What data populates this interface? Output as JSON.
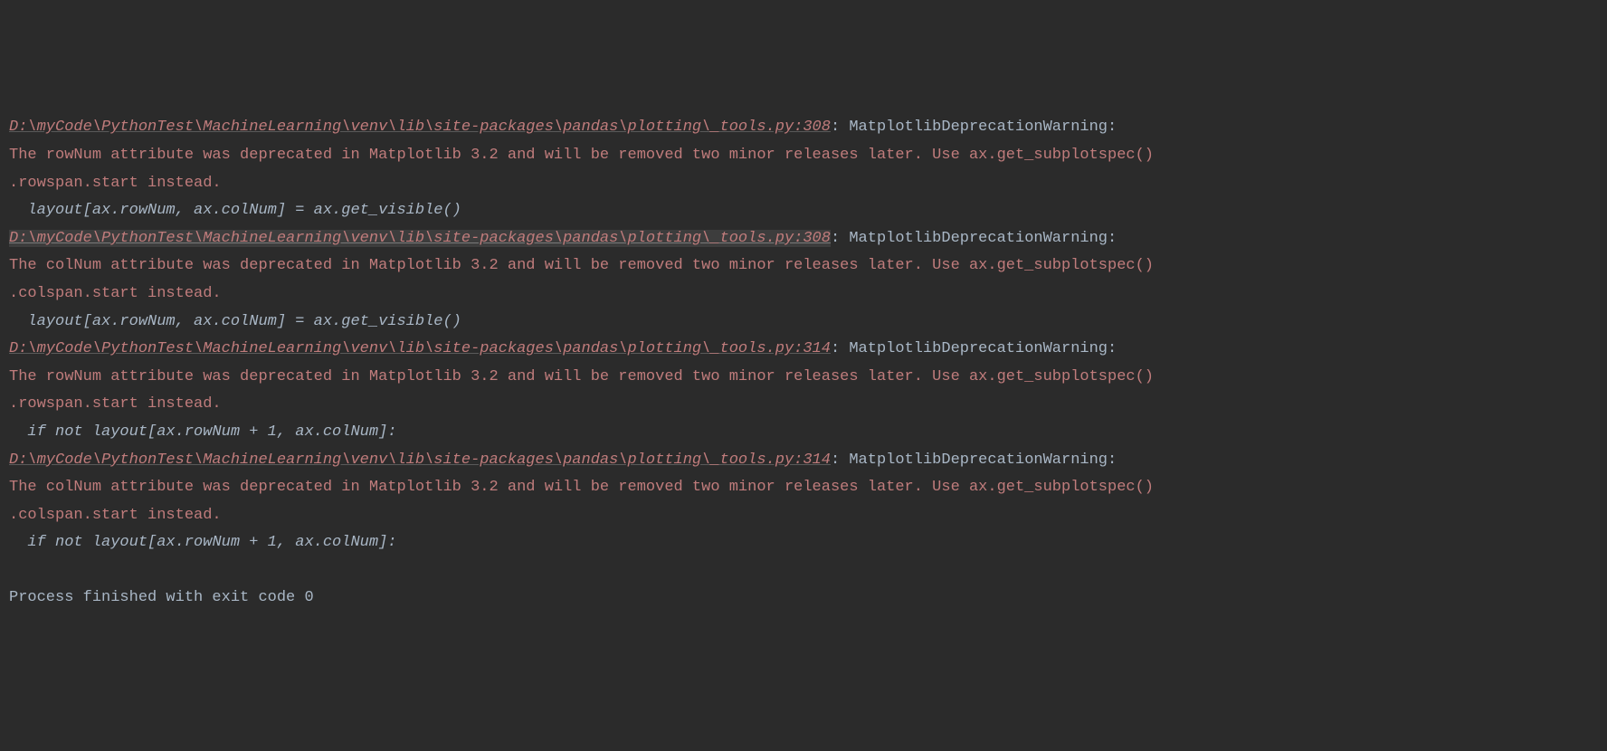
{
  "warnings": [
    {
      "path": "D:\\myCode\\PythonTest\\MachineLearning\\venv\\lib\\site-packages\\pandas\\plotting\\_tools.py:308",
      "pathSelected": false,
      "sep": ": ",
      "warnType": "MatplotlibDeprecationWarning: ",
      "msgLine1": "The rowNum attribute was deprecated in Matplotlib 3.2 and will be removed two minor releases later. Use ax.get_subplotspec()",
      "msgLine2": ".rowspan.start instead.",
      "codeLine": "  layout[ax.rowNum, ax.colNum] = ax.get_visible()"
    },
    {
      "path": "D:\\myCode\\PythonTest\\MachineLearning\\venv\\lib\\site-packages\\pandas\\plotting\\_tools.py:308",
      "pathSelected": true,
      "sep": ": ",
      "warnType": "MatplotlibDeprecationWarning: ",
      "msgLine1": "The colNum attribute was deprecated in Matplotlib 3.2 and will be removed two minor releases later. Use ax.get_subplotspec()",
      "msgLine2": ".colspan.start instead.",
      "codeLine": "  layout[ax.rowNum, ax.colNum] = ax.get_visible()"
    },
    {
      "path": "D:\\myCode\\PythonTest\\MachineLearning\\venv\\lib\\site-packages\\pandas\\plotting\\_tools.py:314",
      "pathSelected": false,
      "sep": ": ",
      "warnType": "MatplotlibDeprecationWarning: ",
      "msgLine1": "The rowNum attribute was deprecated in Matplotlib 3.2 and will be removed two minor releases later. Use ax.get_subplotspec()",
      "msgLine2": ".rowspan.start instead.",
      "codeLine": "  if not layout[ax.rowNum + 1, ax.colNum]:"
    },
    {
      "path": "D:\\myCode\\PythonTest\\MachineLearning\\venv\\lib\\site-packages\\pandas\\plotting\\_tools.py:314",
      "pathSelected": false,
      "sep": ": ",
      "warnType": "MatplotlibDeprecationWarning: ",
      "msgLine1": "The colNum attribute was deprecated in Matplotlib 3.2 and will be removed two minor releases later. Use ax.get_subplotspec()",
      "msgLine2": ".colspan.start instead.",
      "codeLine": "  if not layout[ax.rowNum + 1, ax.colNum]:"
    }
  ],
  "process": "Process finished with exit code 0"
}
